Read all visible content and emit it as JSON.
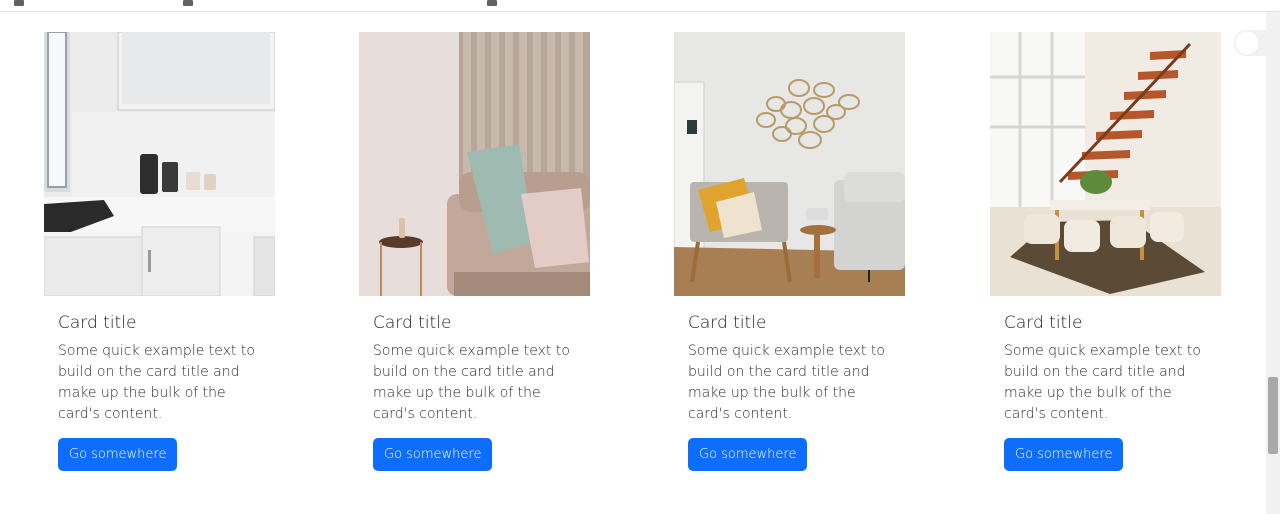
{
  "cards": [
    {
      "title": "Card title",
      "text": "Some quick example text to build on the card title and make up the bulk of the card's content.",
      "button": "Go somewhere",
      "image": "kitchen-photo"
    },
    {
      "title": "Card title",
      "text": "Some quick example text to build on the card title and make up the bulk of the card's content.",
      "button": "Go somewhere",
      "image": "sofa-photo"
    },
    {
      "title": "Card title",
      "text": "Some quick example text to build on the card title and make up the bulk of the card's content.",
      "button": "Go somewhere",
      "image": "living-room-photo"
    },
    {
      "title": "Card title",
      "text": "Some quick example text to build on the card title and make up the bulk of the card's content.",
      "button": "Go somewhere",
      "image": "dining-room-photo"
    }
  ],
  "colors": {
    "button": "#0d6efd",
    "button_text": "#ffffff"
  }
}
